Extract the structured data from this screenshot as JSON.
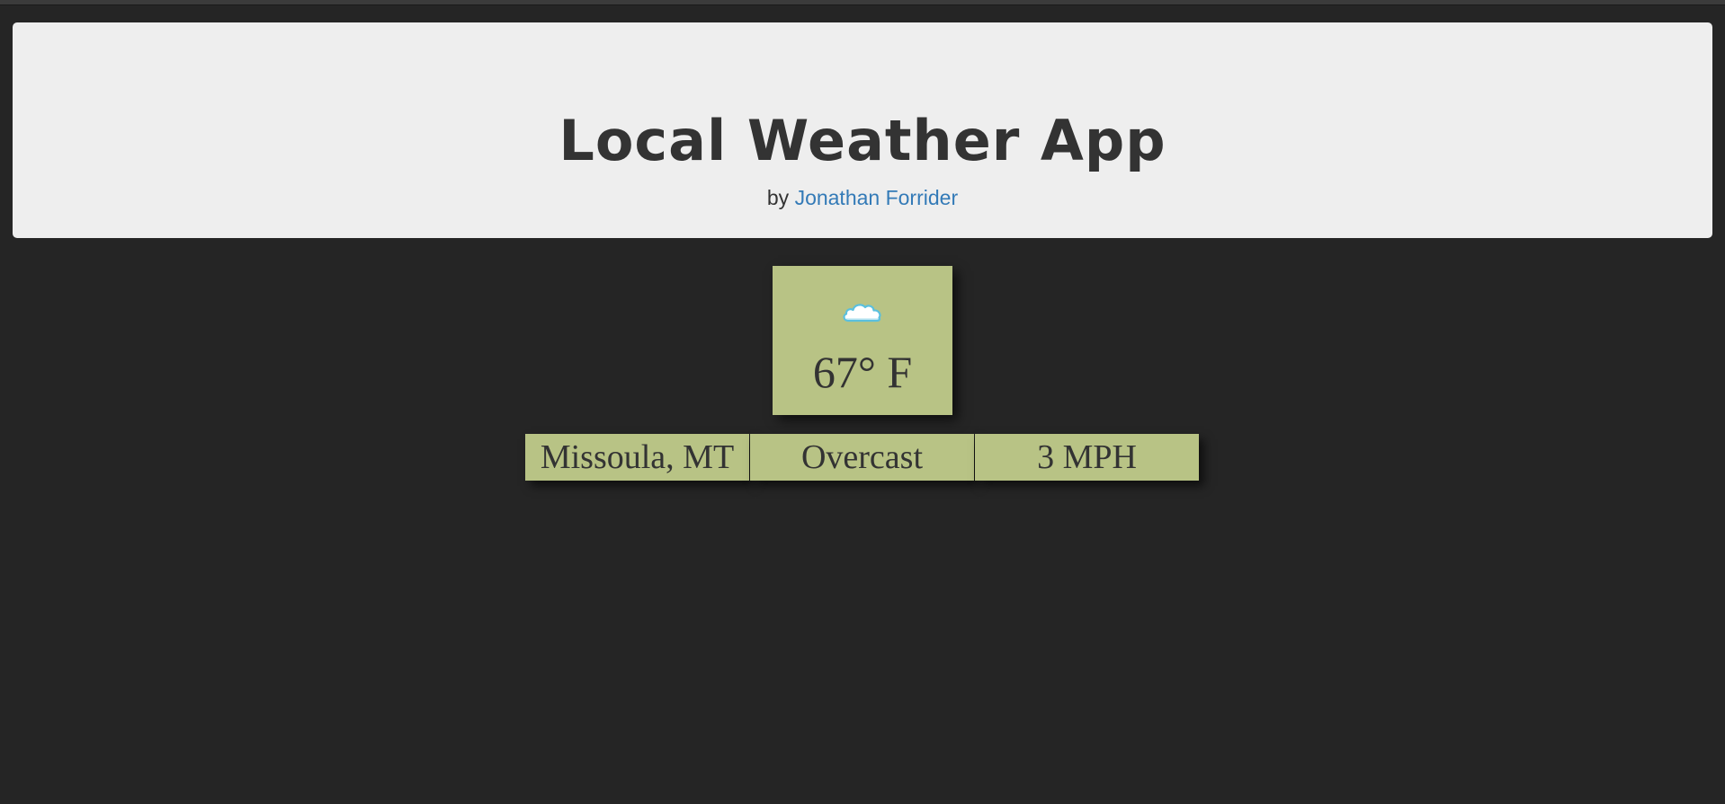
{
  "header": {
    "title": "Local Weather App",
    "byline_prefix": "by",
    "author_name": "Jonathan Forrider"
  },
  "weather": {
    "icon": "cloud-icon",
    "temperature": "67° F",
    "location": "Missoula, MT",
    "condition": "Overcast",
    "wind": "3 MPH"
  },
  "colors": {
    "page_background": "#252525",
    "header_background": "#eeeeee",
    "card_background": "#b8c385",
    "text": "#333333",
    "link": "#337ab7"
  }
}
